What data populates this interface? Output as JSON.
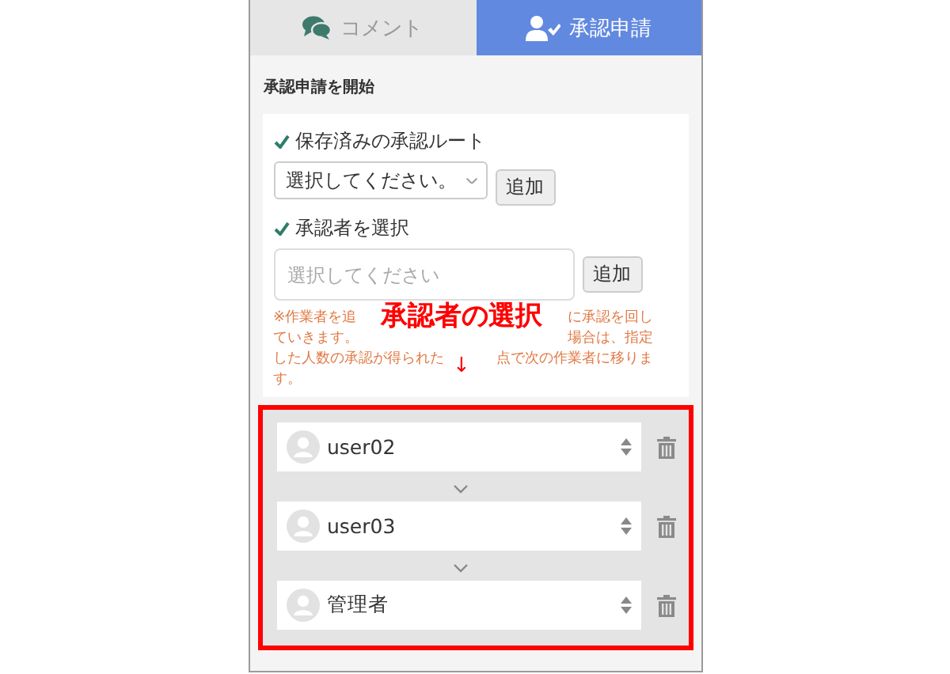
{
  "tabs": [
    {
      "label": "コメント",
      "selected": false
    },
    {
      "label": "承認申請",
      "selected": true
    }
  ],
  "heading": "承認申請を開始",
  "route": {
    "label": "保存済みの承認ルート",
    "select_value": "選択してください。",
    "button": "追加"
  },
  "approver": {
    "label": "承認者を選択",
    "placeholder": "選択してください",
    "button": "追加"
  },
  "note_lines": [
    {
      "left": "※作業者を追",
      "right": "に承認を回し"
    },
    {
      "left": "ていきます。",
      "right": "場合は、指定"
    },
    {
      "left": "した人数の承認が得られた",
      "right": "点で次の作業者に移りま"
    },
    {
      "left": "す。"
    }
  ],
  "annotation": {
    "text": "承認者の選択",
    "arrow": "↓"
  },
  "approvers": [
    {
      "name": "user02"
    },
    {
      "name": "user03"
    },
    {
      "name": "管理者"
    }
  ]
}
